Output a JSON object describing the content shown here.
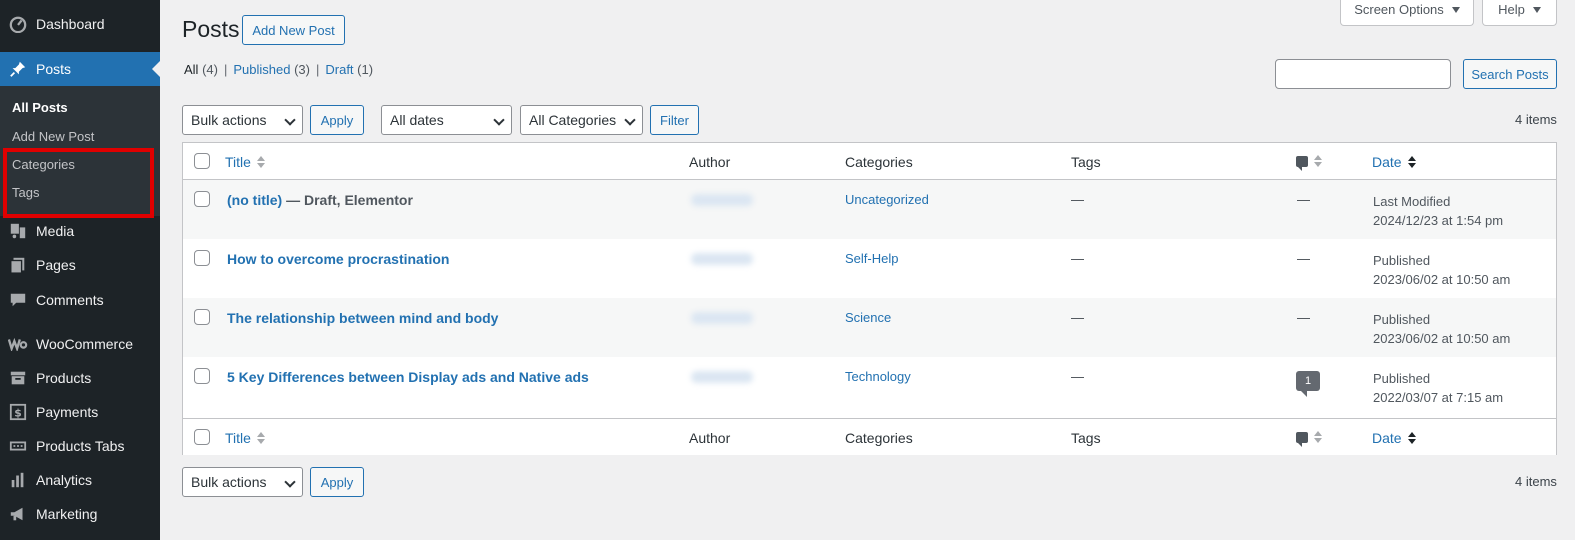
{
  "sidebar": {
    "menu": [
      {
        "label": "Dashboard",
        "icon": "dashboard-icon"
      },
      {
        "label": "Posts",
        "icon": "pin-icon"
      },
      {
        "label": "Media",
        "icon": "media-icon"
      },
      {
        "label": "Pages",
        "icon": "pages-icon"
      },
      {
        "label": "Comments",
        "icon": "comments-icon"
      },
      {
        "label": "WooCommerce",
        "icon": "woocommerce-icon"
      },
      {
        "label": "Products",
        "icon": "archive-icon"
      },
      {
        "label": "Payments",
        "icon": "dollar-icon"
      },
      {
        "label": "Products Tabs",
        "icon": "tabs-icon"
      },
      {
        "label": "Analytics",
        "icon": "bar-chart-icon"
      },
      {
        "label": "Marketing",
        "icon": "megaphone-icon"
      }
    ],
    "submenu": [
      "All Posts",
      "Add New Post",
      "Categories",
      "Tags"
    ],
    "highlight_color": "#e00000"
  },
  "header": {
    "title": "Posts",
    "add_new": "Add New Post",
    "screen_options": "Screen Options",
    "help": "Help"
  },
  "filters": {
    "all_label": "All",
    "all_count": "(4)",
    "published_label": "Published",
    "published_count": "(3)",
    "draft_label": "Draft",
    "draft_count": "(1)",
    "separator": "|"
  },
  "search": {
    "value": "",
    "button": "Search Posts"
  },
  "toolbar": {
    "bulk_actions": "Bulk actions",
    "apply": "Apply",
    "all_dates": "All dates",
    "all_categories": "All Categories",
    "filter": "Filter",
    "items_count": "4 items"
  },
  "table": {
    "columns": {
      "title": "Title",
      "author": "Author",
      "categories": "Categories",
      "tags": "Tags",
      "date": "Date"
    },
    "rows": [
      {
        "title": "(no title)",
        "state": " — Draft, Elementor",
        "category": "Uncategorized",
        "tags": "—",
        "comments": "—",
        "date_status": "Last Modified",
        "date": "2024/12/23 at 1:54 pm"
      },
      {
        "title": "How to overcome procrastination",
        "state": "",
        "category": "Self-Help",
        "tags": "—",
        "comments": "—",
        "date_status": "Published",
        "date": "2023/06/02 at 10:50 am"
      },
      {
        "title": "The relationship between mind and body",
        "state": "",
        "category": "Science",
        "tags": "—",
        "comments": "—",
        "date_status": "Published",
        "date": "2023/06/02 at 10:50 am"
      },
      {
        "title": "5 Key Differences between Display ads and Native ads",
        "state": "",
        "category": "Technology",
        "tags": "—",
        "comments": "1",
        "date_status": "Published",
        "date": "2022/03/07 at 7:15 am"
      }
    ]
  },
  "colors": {
    "accent": "#2271b1",
    "sidebar_bg": "#1d2327",
    "page_bg": "#f0f0f1"
  }
}
